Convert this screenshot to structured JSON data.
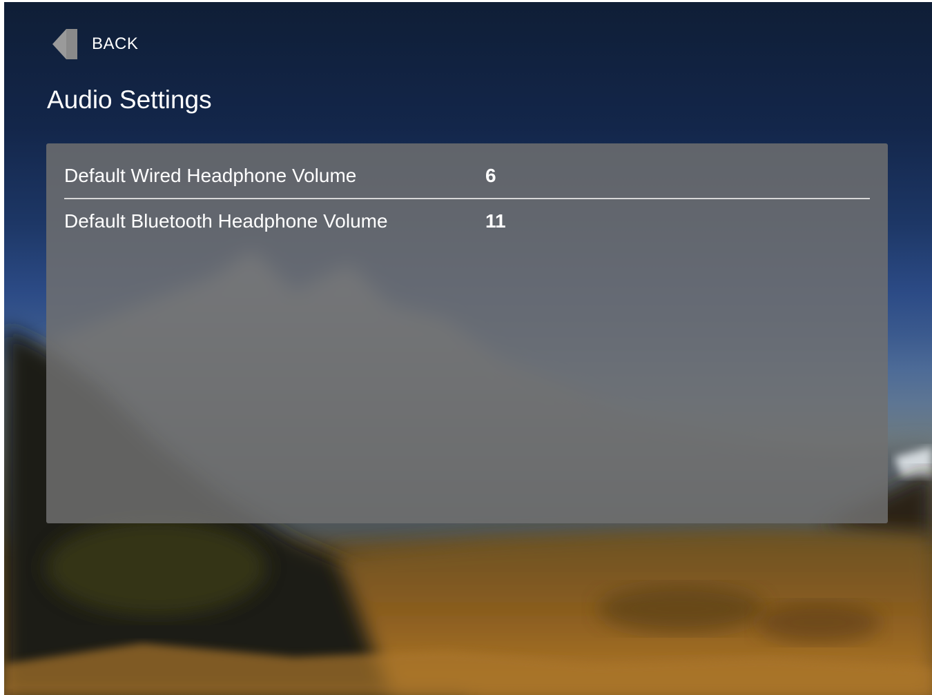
{
  "header": {
    "back_label": "BACK",
    "back_icon": "arrow-left-icon",
    "title": "Audio Settings"
  },
  "settings": [
    {
      "label": "Default Wired Headphone Volume",
      "value": "6"
    },
    {
      "label": "Default Bluetooth Headphone Volume",
      "value": "11"
    }
  ],
  "colors": {
    "panel": "#707070",
    "divider": "#d8d8d8",
    "text": "#ffffff",
    "sky_top": "#0f1e36",
    "ground": "#6a4c20"
  }
}
